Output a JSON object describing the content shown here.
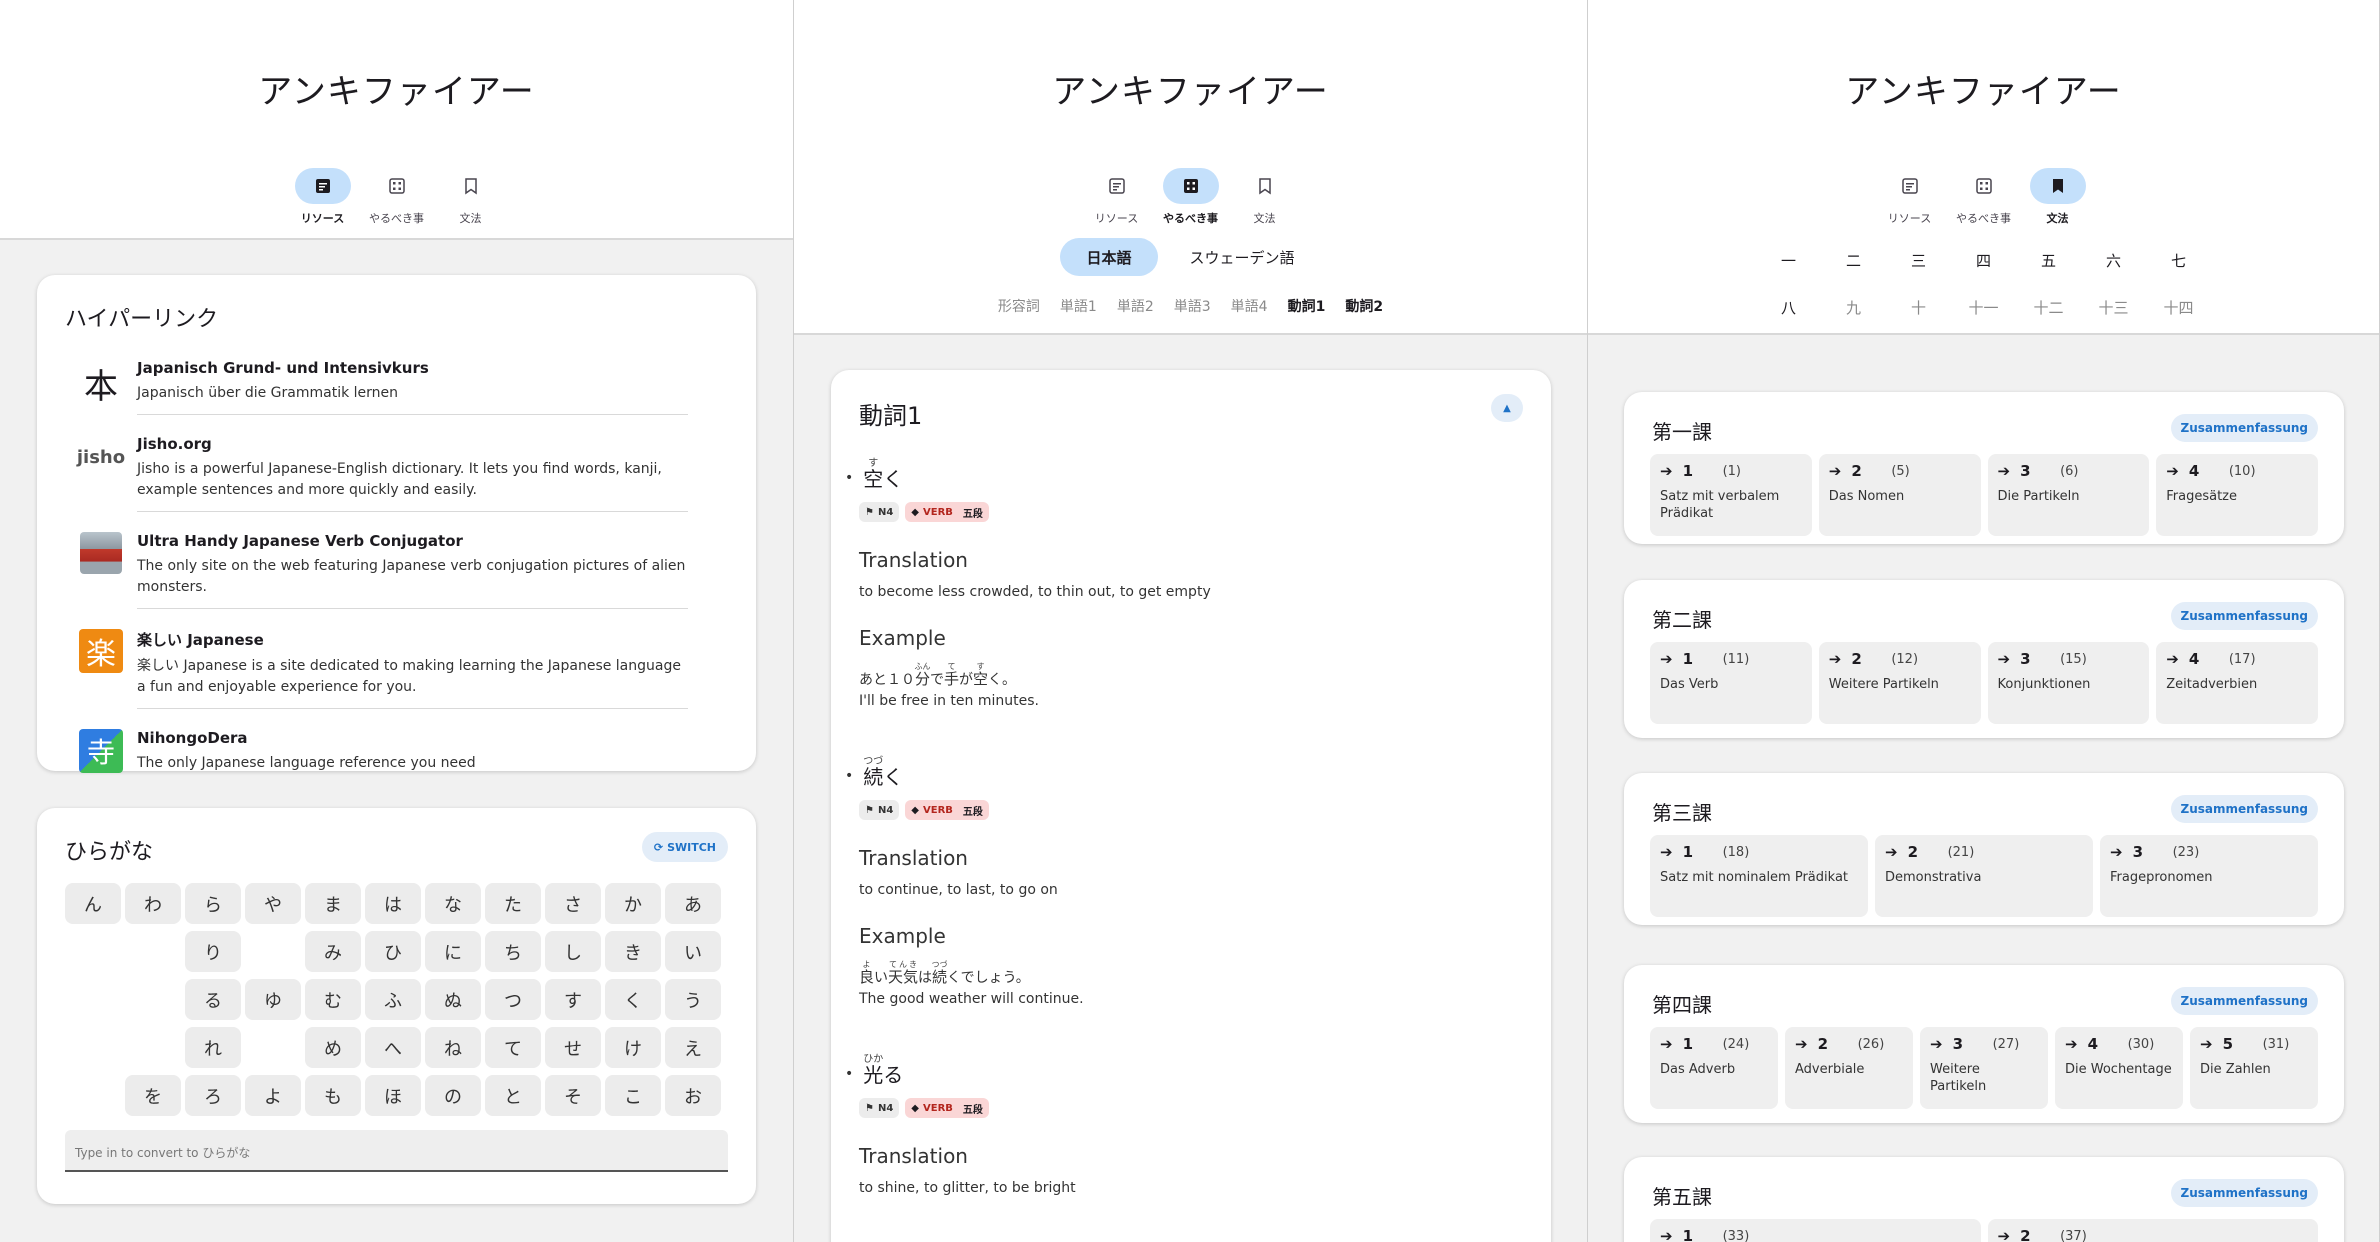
{
  "app_title": "アンキファイアー",
  "nav": [
    {
      "label": "リソース",
      "icon": "note-icon"
    },
    {
      "label": "やるべき事",
      "icon": "grid-icon"
    },
    {
      "label": "文法",
      "icon": "bookmark-icon"
    }
  ],
  "resources": {
    "title": "ハイパーリンク",
    "links": [
      {
        "icon": "本",
        "title": "Japanisch Grund- und Intensivkurs",
        "desc": "Japanisch über die Grammatik lernen"
      },
      {
        "icon": "jisho",
        "title": "Jisho.org",
        "desc": "Jisho is a powerful Japanese-English dictionary. It lets you find words, kanji, example sentences and more quickly and easily."
      },
      {
        "icon": "ultraman",
        "title": "Ultra Handy Japanese Verb Conjugator",
        "desc": "The only site on the web featuring Japanese verb conjugation pictures of alien monsters."
      },
      {
        "icon": "楽",
        "title": "楽しい Japanese",
        "desc": "楽しい Japanese is a site dedicated to making learning the Japanese language a fun and enjoyable experience for you."
      },
      {
        "icon": "寺",
        "title": "NihongoDera",
        "desc": "The only Japanese language reference you need"
      }
    ]
  },
  "kana": {
    "title": "ひらがな",
    "switch_label": "SWITCH",
    "input_placeholder": "Type in to convert to ひらがな",
    "rows": [
      [
        "ん",
        "わ",
        "ら",
        "や",
        "ま",
        "は",
        "な",
        "た",
        "さ",
        "か",
        "あ"
      ],
      [
        "",
        "",
        "り",
        "",
        "み",
        "ひ",
        "に",
        "ち",
        "し",
        "き",
        "い"
      ],
      [
        "",
        "",
        "る",
        "ゆ",
        "む",
        "ふ",
        "ぬ",
        "つ",
        "す",
        "く",
        "う"
      ],
      [
        "",
        "",
        "れ",
        "",
        "め",
        "へ",
        "ね",
        "て",
        "せ",
        "け",
        "え"
      ],
      [
        "",
        "を",
        "ろ",
        "よ",
        "も",
        "ほ",
        "の",
        "と",
        "そ",
        "こ",
        "お"
      ]
    ]
  },
  "todo": {
    "lang_tabs": [
      "日本語",
      "スウェーデン語"
    ],
    "categories": [
      "形容詞",
      "単語1",
      "単語2",
      "単語3",
      "単語4",
      "動詞1",
      "動詞2"
    ],
    "card_title": "動詞1",
    "translation_label": "Translation",
    "example_label": "Example",
    "verbs": [
      {
        "kanji": "空",
        "okurigana": "く",
        "reading": "す",
        "tags": [
          "N4",
          "VERB",
          "五段"
        ],
        "translation": "to become less crowded, to thin out, to get empty",
        "example_pre": "あと１０",
        "example_r1": "分",
        "example_r1t": "ふん",
        "example_mid1": "で",
        "example_r2": "手",
        "example_r2t": "て",
        "example_mid2": "が",
        "example_r3": "空",
        "example_r3t": "す",
        "example_post": "く。",
        "example_en": "I'll be free in ten minutes."
      },
      {
        "kanji": "続",
        "okurigana": "く",
        "reading": "つづ",
        "tags": [
          "N4",
          "VERB",
          "五段"
        ],
        "translation": "to continue, to last, to go on",
        "example_pre": "",
        "example_r1": "良",
        "example_r1t": "よ",
        "example_mid1": "い",
        "example_r2": "天気",
        "example_r2t": "てんき",
        "example_mid2": "は",
        "example_r3": "続",
        "example_r3t": "つづ",
        "example_post": "くでしょう。",
        "example_en": "The good weather will continue."
      },
      {
        "kanji": "光",
        "okurigana": "る",
        "reading": "ひか",
        "tags": [
          "N4",
          "VERB",
          "五段"
        ],
        "translation": "to shine, to glitter, to be bright"
      }
    ]
  },
  "grammar": {
    "kanji_row1": [
      "一",
      "二",
      "三",
      "四",
      "五",
      "六",
      "七"
    ],
    "kanji_row2": [
      "八",
      "九",
      "十",
      "十一",
      "十二",
      "十三",
      "十四"
    ],
    "summary_label": "Zusammenfassung",
    "lessons": [
      {
        "title": "第一課",
        "topics": [
          {
            "n": "1",
            "c": "(1)",
            "label": "Satz mit verbalem Prädikat"
          },
          {
            "n": "2",
            "c": "(5)",
            "label": "Das Nomen"
          },
          {
            "n": "3",
            "c": "(6)",
            "label": "Die Partikeln"
          },
          {
            "n": "4",
            "c": "(10)",
            "label": "Fragesätze"
          }
        ]
      },
      {
        "title": "第二課",
        "topics": [
          {
            "n": "1",
            "c": "(11)",
            "label": "Das Verb"
          },
          {
            "n": "2",
            "c": "(12)",
            "label": "Weitere Partikeln"
          },
          {
            "n": "3",
            "c": "(15)",
            "label": "Konjunktionen"
          },
          {
            "n": "4",
            "c": "(17)",
            "label": "Zeitadverbien"
          }
        ]
      },
      {
        "title": "第三課",
        "topics": [
          {
            "n": "1",
            "c": "(18)",
            "label": "Satz mit nominalem Prädikat"
          },
          {
            "n": "2",
            "c": "(21)",
            "label": "Demonstrativa"
          },
          {
            "n": "3",
            "c": "(23)",
            "label": "Fragepronomen"
          }
        ]
      },
      {
        "title": "第四課",
        "topics": [
          {
            "n": "1",
            "c": "(24)",
            "label": "Das Adverb"
          },
          {
            "n": "2",
            "c": "(26)",
            "label": "Adverbiale"
          },
          {
            "n": "3",
            "c": "(27)",
            "label": "Weitere Partikeln"
          },
          {
            "n": "4",
            "c": "(30)",
            "label": "Die Wochentage"
          },
          {
            "n": "5",
            "c": "(31)",
            "label": "Die Zahlen"
          }
        ]
      },
      {
        "title": "第五課",
        "topics": [
          {
            "n": "1",
            "c": "(33)",
            "label": ""
          },
          {
            "n": "2",
            "c": "(37)",
            "label": ""
          }
        ]
      }
    ]
  }
}
